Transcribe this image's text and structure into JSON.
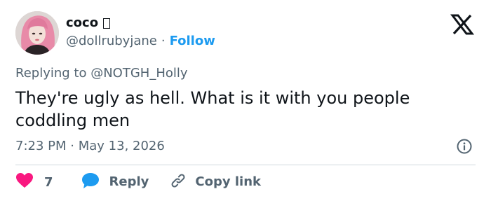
{
  "author": {
    "display_name": "coco",
    "handle": "@dollrubyjane",
    "separator": "·",
    "follow_label": "Follow"
  },
  "reply": {
    "prefix": "Replying to",
    "target": "@NOTGH_Holly"
  },
  "tweet": {
    "text": "They're ugly as hell. What is it with you people coddling men"
  },
  "meta": {
    "time": "7:23 PM",
    "separator": "·",
    "date": "May 13, 2026"
  },
  "actions": {
    "like_count": "7",
    "reply_label": "Reply",
    "copy_link_label": "Copy link"
  },
  "colors": {
    "like": "#f91880",
    "reply_icon": "#1d9bf0",
    "link": "#1d9bf0",
    "muted": "#536471",
    "text": "#0f1419"
  },
  "icons": {
    "platform": "x-logo-icon",
    "info": "info-icon",
    "like": "heart-icon",
    "reply": "speech-bubble-icon",
    "copy": "link-icon"
  }
}
